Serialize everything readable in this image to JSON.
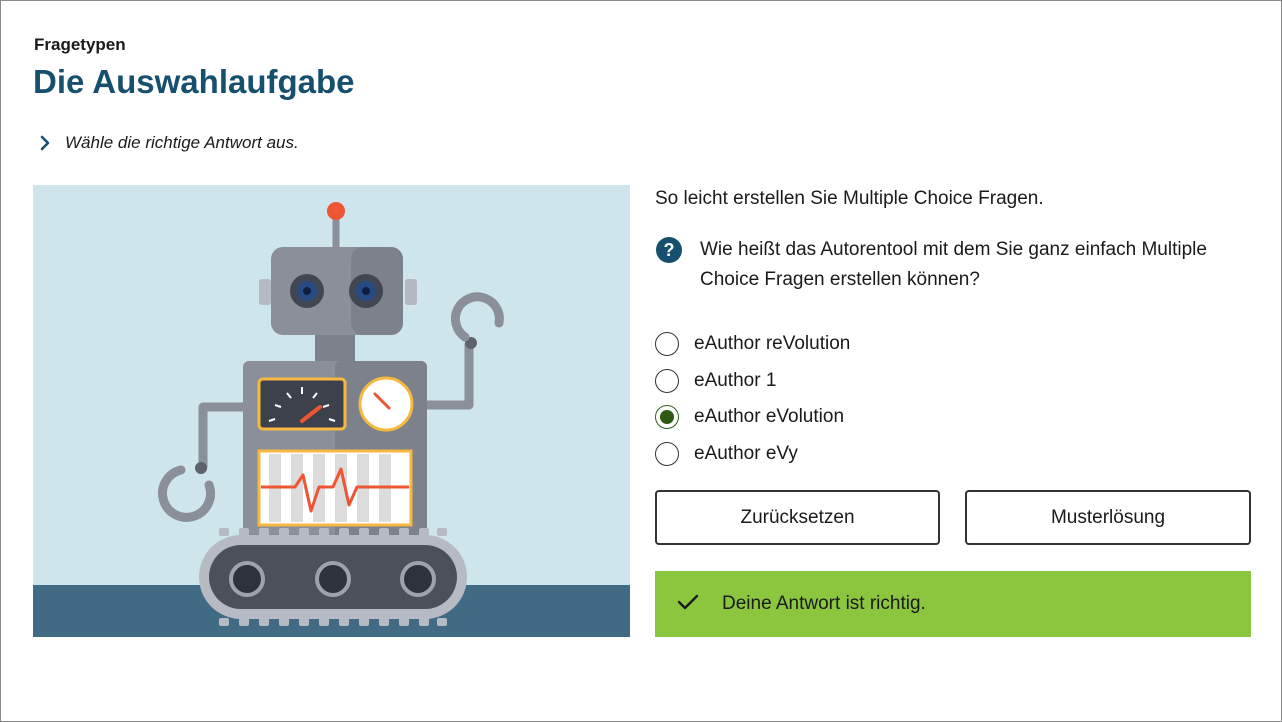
{
  "header": {
    "category": "Fragetypen",
    "title": "Die Auswahlaufgabe"
  },
  "instruction": {
    "text": "Wähle die richtige Antwort aus.",
    "icon": "chevron-right-icon"
  },
  "illustration": {
    "subject": "robot-illustration"
  },
  "question": {
    "intro": "So leicht erstellen Sie Multiple Choice Fragen.",
    "text": "Wie heißt das Autorentool mit dem Sie ganz einfach Multiple Choice Fragen erstellen können?",
    "icon": "question-mark-icon",
    "options": [
      {
        "label": "eAuthor reVolution",
        "selected": false
      },
      {
        "label": "eAuthor 1",
        "selected": false
      },
      {
        "label": "eAuthor eVolution",
        "selected": true
      },
      {
        "label": "eAuthor eVy",
        "selected": false
      }
    ]
  },
  "buttons": {
    "reset": "Zurücksetzen",
    "solution": "Musterlösung"
  },
  "feedback": {
    "text": "Deine Antwort ist richtig.",
    "icon": "checkmark-icon",
    "status": "correct"
  },
  "colors": {
    "title": "#174f6e",
    "feedback_background": "#8cc63f",
    "selected_radio": "#2f5a12",
    "illustration_sky": "#cfe5ec",
    "illustration_floor": "#416a85"
  }
}
